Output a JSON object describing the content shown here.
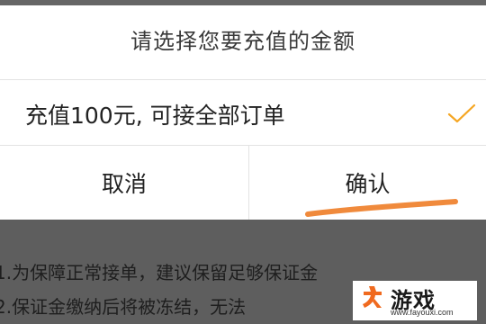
{
  "dialog": {
    "title": "请选择您要充值的金额",
    "option": {
      "label": "充值100元, 可接全部订单",
      "selected": true,
      "check_icon": "checkmark-icon",
      "check_color": "#f5a623"
    },
    "cancel_label": "取消",
    "confirm_label": "确认"
  },
  "background": {
    "lines": [
      "1.为保障正常接单，建议保留足够保证金",
      "2.保证金缴纳后将被冻结，无法"
    ]
  },
  "watermark": {
    "name": "游戏",
    "url": "www.fayouxi.com",
    "logo_icon": "fa-logo-icon",
    "accent": "#f06a1f"
  },
  "colors": {
    "overlay": "#5e5e5e",
    "highlight_stroke": "#f08a3c"
  }
}
